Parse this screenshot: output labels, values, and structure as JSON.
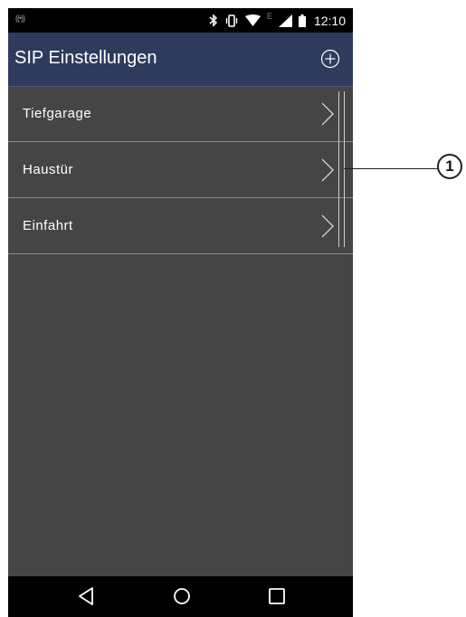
{
  "status_bar": {
    "time": "12:10",
    "network_letter": "E",
    "left_icon": "((•))",
    "icons": [
      "bluetooth-icon",
      "vibrate-icon",
      "wifi-icon",
      "signal-icon",
      "battery-icon"
    ]
  },
  "app_bar": {
    "title": "SIP Einstellungen",
    "add_icon": "plus-circle-icon"
  },
  "list": {
    "items": [
      {
        "label": "Tiefgarage"
      },
      {
        "label": "Haustür"
      },
      {
        "label": "Einfahrt"
      }
    ]
  },
  "nav_bar": {
    "buttons": [
      "back-icon",
      "home-icon",
      "recents-icon"
    ]
  },
  "callout": {
    "number": "1"
  },
  "colors": {
    "app_bar": "#2e3b5d",
    "background": "#444544",
    "status_bar": "#000000",
    "divider": "#8b8b8b"
  }
}
